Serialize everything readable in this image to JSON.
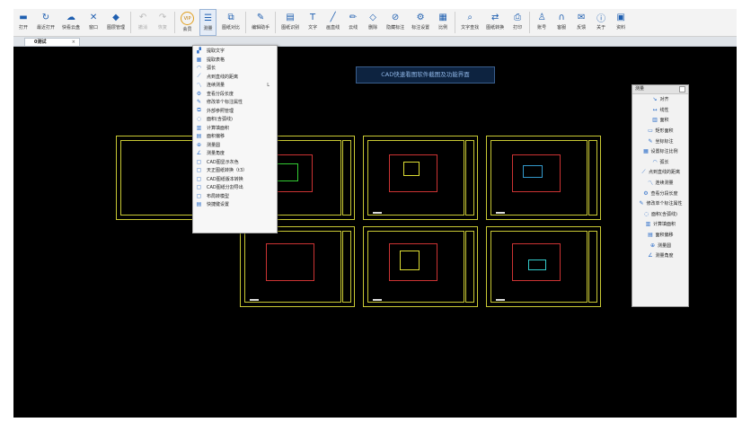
{
  "toolbar": {
    "buttons": [
      {
        "name": "open-button",
        "label": "打开",
        "icon": "folder-icon",
        "glyph": "▬",
        "state": "normal"
      },
      {
        "name": "recent-open-button",
        "label": "最近打开",
        "icon": "history-icon",
        "glyph": "↻",
        "state": "normal"
      },
      {
        "name": "fast-cloud-button",
        "label": "快看云盘",
        "icon": "cloud-icon",
        "glyph": "☁",
        "state": "normal"
      },
      {
        "name": "window-button",
        "label": "窗口",
        "icon": "window-icon",
        "glyph": "✕",
        "state": "normal"
      },
      {
        "name": "layer-manage-button",
        "label": "图层管理",
        "icon": "layers-icon",
        "glyph": "◆",
        "state": "normal"
      },
      {
        "name": "undo-button",
        "label": "撤消",
        "icon": "undo-icon",
        "glyph": "↶",
        "state": "disabled"
      },
      {
        "name": "redo-button",
        "label": "恢复",
        "icon": "redo-icon",
        "glyph": "↷",
        "state": "disabled"
      },
      {
        "name": "vip-button",
        "label": "会员",
        "icon": "vip-icon",
        "glyph": "VIP",
        "state": "normal"
      },
      {
        "name": "measure-button",
        "label": "测量",
        "icon": "ruler-icon",
        "glyph": "☰",
        "state": "active"
      },
      {
        "name": "drawing-compare-button",
        "label": "图纸对比",
        "icon": "compare-icon",
        "glyph": "⧉",
        "state": "normal"
      },
      {
        "name": "edit-assistant-button",
        "label": "编辑助手",
        "icon": "edit-assistant-icon",
        "glyph": "✎",
        "state": "normal"
      },
      {
        "name": "drawing-recognize-button",
        "label": "图纸识别",
        "icon": "recognize-icon",
        "glyph": "▤",
        "state": "normal"
      },
      {
        "name": "text-button",
        "label": "文字",
        "icon": "text-icon",
        "glyph": "T",
        "state": "normal"
      },
      {
        "name": "line-button",
        "label": "画直线",
        "icon": "line-icon",
        "glyph": "╱",
        "state": "normal"
      },
      {
        "name": "cloud-line-button",
        "label": "云线",
        "icon": "pencil-icon",
        "glyph": "✏",
        "state": "normal"
      },
      {
        "name": "delete-button",
        "label": "删除",
        "icon": "eraser-icon",
        "glyph": "◇",
        "state": "normal"
      },
      {
        "name": "hide-mark-button",
        "label": "隐藏标注",
        "icon": "hide-icon",
        "glyph": "⊘",
        "state": "normal"
      },
      {
        "name": "mark-settings-button",
        "label": "标注设置",
        "icon": "settings-icon",
        "glyph": "⚙",
        "state": "normal"
      },
      {
        "name": "scale-button",
        "label": "比例",
        "icon": "scale-icon",
        "glyph": "▦",
        "state": "normal"
      },
      {
        "name": "text-search-button",
        "label": "文字查找",
        "icon": "search-icon",
        "glyph": "⌕",
        "state": "normal"
      },
      {
        "name": "convert-format-button",
        "label": "图纸转换",
        "icon": "convert-icon",
        "glyph": "⇄",
        "state": "normal"
      },
      {
        "name": "print-button",
        "label": "打印",
        "icon": "printer-icon",
        "glyph": "⎙",
        "state": "normal"
      },
      {
        "name": "account-button",
        "label": "账号",
        "icon": "user-icon",
        "glyph": "♙",
        "state": "normal"
      },
      {
        "name": "help-button",
        "label": "客服",
        "icon": "headset-icon",
        "glyph": "∩",
        "state": "normal"
      },
      {
        "name": "feedback-button",
        "label": "反馈",
        "icon": "feedback-icon",
        "glyph": "✉",
        "state": "normal"
      },
      {
        "name": "about-button",
        "label": "关于",
        "icon": "info-icon",
        "glyph": "ⓘ",
        "state": "normal"
      },
      {
        "name": "resources-button",
        "label": "资料",
        "icon": "resources-icon",
        "glyph": "▣",
        "state": "normal"
      }
    ]
  },
  "tabs": {
    "active_label": "0测试",
    "close_glyph": "×"
  },
  "banner": {
    "text": "CAD快速看图软件截图及功能界面"
  },
  "measure_menu": {
    "items": [
      {
        "label": "提取文字",
        "icon": "extract-text-icon",
        "glyph": "▞",
        "shortcut": ""
      },
      {
        "label": "提取表格",
        "icon": "table-icon",
        "glyph": "▦",
        "shortcut": ""
      },
      {
        "label": "弧长",
        "icon": "arc-icon",
        "glyph": "◠",
        "shortcut": ""
      },
      {
        "label": "点到直线的距离",
        "icon": "point-line-icon",
        "glyph": "⟋",
        "shortcut": ""
      },
      {
        "label": "连续测量",
        "icon": "continuous-measure-icon",
        "glyph": "〽",
        "shortcut": "L"
      },
      {
        "label": "查看分段长度",
        "icon": "segment-length-icon",
        "glyph": "⚙",
        "shortcut": ""
      },
      {
        "label": "修改单个标注属性",
        "icon": "edit-mark-icon",
        "glyph": "✎",
        "shortcut": ""
      },
      {
        "label": "外部参照管理",
        "icon": "xref-icon",
        "glyph": "⧉",
        "shortcut": ""
      },
      {
        "label": "面积(含弧线)",
        "icon": "area-arc-icon",
        "glyph": "◌",
        "shortcut": ""
      },
      {
        "label": "计算填面积",
        "icon": "fill-area-icon",
        "glyph": "▥",
        "shortcut": ""
      },
      {
        "label": "面积偏移",
        "icon": "area-offset-icon",
        "glyph": "▤",
        "shortcut": ""
      },
      {
        "label": "测量圆",
        "icon": "circle-icon",
        "glyph": "⊕",
        "shortcut": ""
      },
      {
        "label": "测量角度",
        "icon": "angle-icon",
        "glyph": "∠",
        "shortcut": ""
      },
      {
        "label": "CAD图显示灰色",
        "icon": "gray-display-icon",
        "glyph": "▢",
        "shortcut": ""
      },
      {
        "label": "天正图纸转换（t3）",
        "icon": "tangent-convert-icon",
        "glyph": "▢",
        "shortcut": ""
      },
      {
        "label": "CAD图纸版本转换",
        "icon": "version-convert-icon",
        "glyph": "▢",
        "shortcut": ""
      },
      {
        "label": "CAD图纸分割导出",
        "icon": "split-export-icon",
        "glyph": "▢",
        "shortcut": ""
      },
      {
        "label": "布局转模型",
        "icon": "layout-model-icon",
        "glyph": "▢",
        "shortcut": ""
      },
      {
        "label": "快捷键设置",
        "icon": "shortcut-icon",
        "glyph": "▤",
        "shortcut": ""
      }
    ]
  },
  "measure_panel": {
    "title": "测量",
    "items": [
      {
        "label": "对齐",
        "icon": "align-icon",
        "glyph": "↘"
      },
      {
        "label": "线性",
        "icon": "linear-icon",
        "glyph": "↔"
      },
      {
        "label": "面积",
        "icon": "area-icon",
        "glyph": "▥"
      },
      {
        "label": "矩形面积",
        "icon": "rect-area-icon",
        "glyph": "▭"
      },
      {
        "label": "坐标标注",
        "icon": "coord-icon",
        "glyph": "✎"
      },
      {
        "label": "设置标注比例",
        "icon": "mark-scale-icon",
        "glyph": "▦"
      },
      {
        "label": "弧长",
        "icon": "arc-icon",
        "glyph": "◠"
      },
      {
        "label": "点到直线的距离",
        "icon": "point-line-icon",
        "glyph": "⟋"
      },
      {
        "label": "连续测量",
        "icon": "continuous-measure-icon",
        "glyph": "〽"
      },
      {
        "label": "查看分段长度",
        "icon": "segment-length-icon",
        "glyph": "⚙"
      },
      {
        "label": "修改单个标注属性",
        "icon": "edit-mark-icon",
        "glyph": "✎"
      },
      {
        "label": "面积(含弧线)",
        "icon": "area-arc-icon",
        "glyph": "◌"
      },
      {
        "label": "计算填面积",
        "icon": "fill-area-icon",
        "glyph": "▥"
      },
      {
        "label": "面积偏移",
        "icon": "area-offset-icon",
        "glyph": "▤"
      },
      {
        "label": "测量圆",
        "icon": "circle-icon",
        "glyph": "⊕"
      },
      {
        "label": "测量角度",
        "icon": "angle-icon",
        "glyph": "∠"
      }
    ]
  },
  "colors": {
    "canvas": "#000000",
    "frame": "#c9c934",
    "wall_red": "#cc3333",
    "accent_blue": "#1f5fb0"
  }
}
